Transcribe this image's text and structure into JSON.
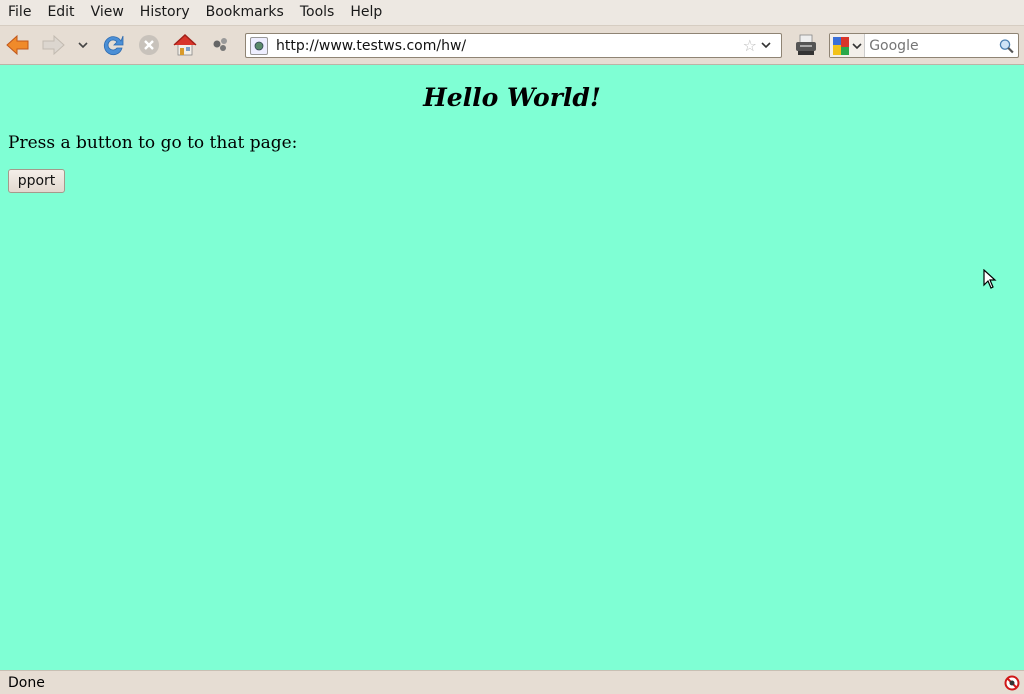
{
  "menubar": {
    "items": [
      {
        "label": "File",
        "accel": "F"
      },
      {
        "label": "Edit",
        "accel": "E"
      },
      {
        "label": "View",
        "accel": "V"
      },
      {
        "label": "History",
        "accel": "s"
      },
      {
        "label": "Bookmarks",
        "accel": "B"
      },
      {
        "label": "Tools",
        "accel": "T"
      },
      {
        "label": "Help",
        "accel": "H"
      }
    ]
  },
  "toolbar": {
    "back_icon": "back-arrow-icon",
    "forward_icon": "forward-arrow-icon",
    "history_dropdown_icon": "chevron-down-icon",
    "reload_icon": "reload-icon",
    "stop_icon": "stop-icon",
    "home_icon": "home-icon",
    "extra_icon": "throbber-icon",
    "print_icon": "printer-icon"
  },
  "urlbar": {
    "value": "http://www.testws.com/hw/"
  },
  "search": {
    "placeholder": "Google",
    "engine_icon": "google-icon"
  },
  "page": {
    "heading": "Hello World!",
    "instruction": "Press a button to go to that page:",
    "button_label": "pport",
    "background": "#7fffd4"
  },
  "statusbar": {
    "text": "Done",
    "icon": "blocked-icon"
  }
}
